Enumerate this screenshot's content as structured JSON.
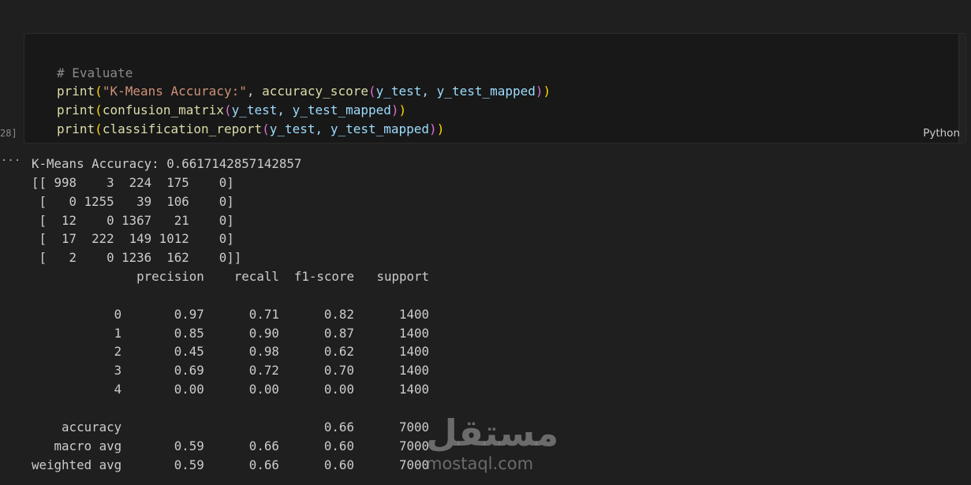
{
  "previous_cell_tail": "      _ \\        \\ \\   _ \\\\ ",
  "code_cell": {
    "lines": [
      {
        "comment": "# Evaluate"
      },
      {
        "fn": "print",
        "str": "\"K-Means Accuracy:\"",
        "inner_fn": "accuracy_score",
        "args": "y_test, y_test_mapped"
      },
      {
        "fn": "print",
        "inner_fn": "confusion_matrix",
        "args": "y_test, y_test_mapped"
      },
      {
        "fn": "print",
        "inner_fn": "classification_report",
        "args": "y_test, y_test_mapped"
      }
    ],
    "language": "Python",
    "execution_count": "28]"
  },
  "output": {
    "dots": "···",
    "text": "K-Means Accuracy: 0.6617142857142857\n[[ 998    3  224  175    0]\n [   0 1255   39  106    0]\n [  12    0 1367   21    0]\n [  17  222  149 1012    0]\n [   2    0 1236  162    0]]\n              precision    recall  f1-score   support\n\n           0       0.97      0.71      0.82      1400\n           1       0.85      0.90      0.87      1400\n           2       0.45      0.98      0.62      1400\n           3       0.69      0.72      0.70      1400\n           4       0.00      0.00      0.00      1400\n\n    accuracy                           0.66      7000\n   macro avg       0.59      0.66      0.60      7000\nweighted avg       0.59      0.66      0.60      7000"
  },
  "watermark": {
    "arabic": "مستقل",
    "latin": "mostaql.com"
  },
  "colors": {
    "background": "#1f1f1f",
    "cell_background": "#181818",
    "comment": "#8a8a8a",
    "function": "#dcdcaa",
    "string": "#ce9178",
    "variable": "#9cdcfe",
    "bracket_outer": "#ffd700",
    "bracket_inner": "#da70d6"
  }
}
